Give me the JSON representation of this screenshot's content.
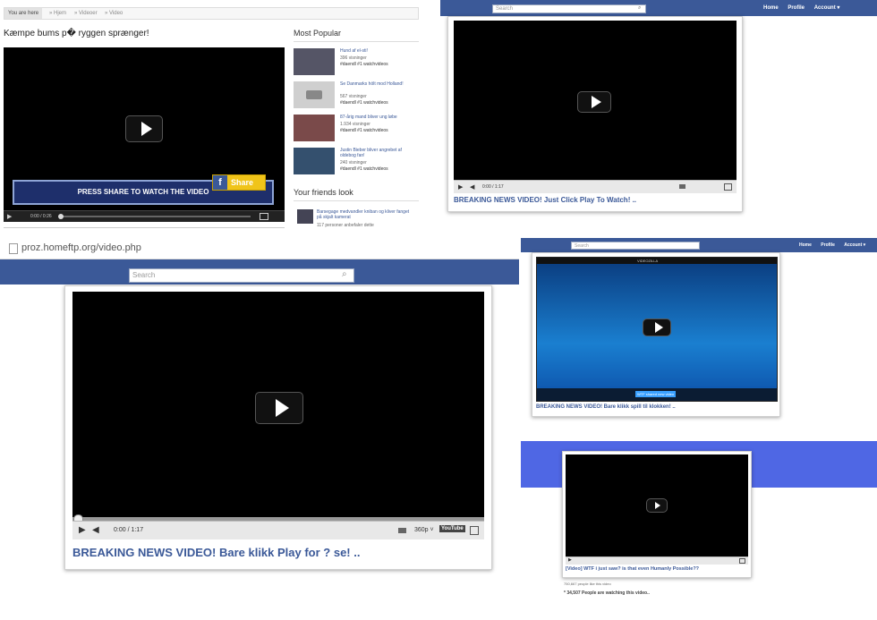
{
  "p1": {
    "breadcrumb": [
      "You are here",
      "» Hjem",
      "» Videoer",
      "» Video"
    ],
    "video_title": "Kæmpe bums p� ryggen sprænger!",
    "overlay": "PRESS SHARE TO WATCH THE VIDEO",
    "share_label": "Share",
    "time": "0:00 / 0:26",
    "most_popular_heading": "Most Popular",
    "popular": [
      {
        "title": "Hund af el-sti!",
        "views": "396 visninger",
        "by": "#daendl #1 watchvideos"
      },
      {
        "title": "Se Danmarks hölt mod Holland!",
        "views": "567 visninger",
        "by": "#daendl #1 watchvideos"
      },
      {
        "title": "87-årig mand bliver ung løbe",
        "views": "1.934 visninger",
        "by": "#daendl #1 watchvideos"
      },
      {
        "title": "Justin Bieber bliver angrebet af oldebog fan!",
        "views": "240 visninger",
        "by": "#daendl #1 watchvideos"
      }
    ],
    "friends_heading": "Your friends look",
    "friend": {
      "title": "Barsegage medvandler kniban og kliver fanget på skjalt kamerat",
      "views": "117 personer anbefaler dette"
    }
  },
  "p2": {
    "search_placeholder": "Search",
    "nav": [
      "Home",
      "Profile",
      "Account ▾"
    ],
    "time": "0:00 / 1:17",
    "headline": "BREAKING NEWS VIDEO! Just Click Play To Watch! .."
  },
  "p3": {
    "url": "proz.homeftp.org/video.php",
    "search_placeholder": "Search",
    "time": "0:00 / 1:17",
    "quality": "360p ˅",
    "yt": "YouTube",
    "headline": "BREAKING NEWS VIDEO! Bare klikk Play for ? se! .."
  },
  "p4": {
    "search_placeholder": "Search",
    "nav": [
      "Home",
      "Profile",
      "Account ▾"
    ],
    "player_brand": "VIDEOZILLA",
    "highlight": "WTF shared new video",
    "headline": "BREAKING NEWS VIDEO! Bare klikk spill til klokken! .."
  },
  "p5": {
    "headline": "[Video] WTF i just saw? is that even Humanly Possible??",
    "small_note": "750,667 people like this video",
    "watching": "* 34,507 People are watching this video.."
  },
  "colors": {
    "fb_blue": "#3b5998",
    "link_blue": "#3b5998",
    "share_yellow": "#f0c419",
    "banner_blue": "#4f67e4"
  }
}
